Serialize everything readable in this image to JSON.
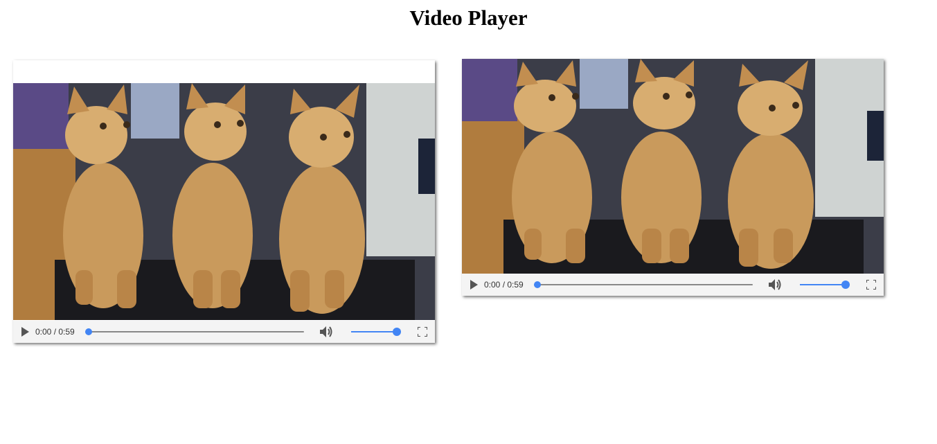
{
  "page": {
    "title": "Video Player"
  },
  "players": [
    {
      "current_time": "0:00",
      "duration": "0:59",
      "time_display": "0:00 / 0:59",
      "progress": 0.0,
      "volume": 1.0,
      "icons": [
        "play-icon",
        "volume-icon",
        "fullscreen-icon"
      ]
    },
    {
      "current_time": "0:00",
      "duration": "0:59",
      "time_display": "0:00 / 0:59",
      "progress": 0.0,
      "volume": 1.0,
      "icons": [
        "play-icon",
        "volume-icon",
        "fullscreen-icon"
      ]
    }
  ],
  "colors": {
    "accent": "#4285f4",
    "controls_background": "#f4f4f4",
    "icon": "#555555"
  }
}
